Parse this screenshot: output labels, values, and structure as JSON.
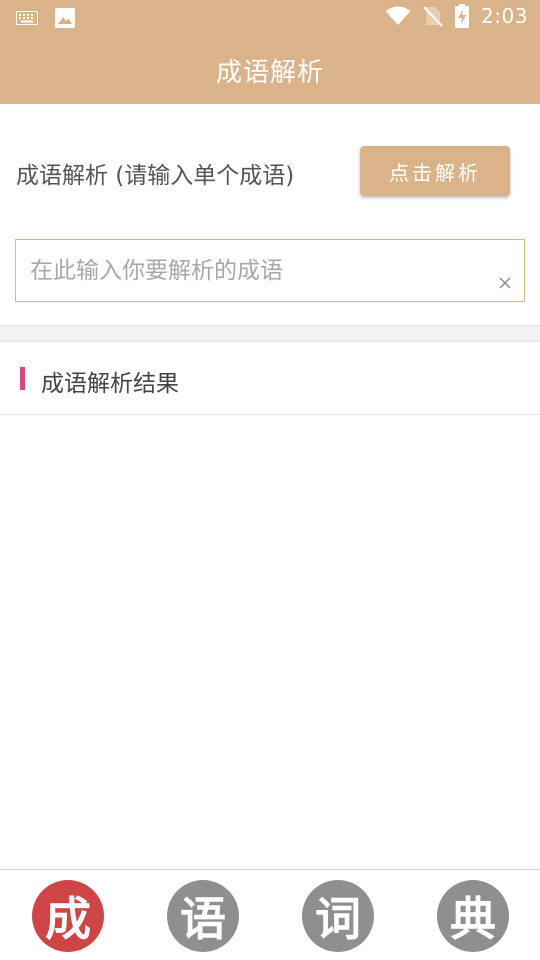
{
  "status_bar": {
    "time": "2:03",
    "left_icons": [
      "keyboard-icon",
      "image-icon"
    ],
    "right_icons": [
      "wifi-icon",
      "no-sim-icon",
      "battery-charging-icon"
    ]
  },
  "app_bar": {
    "title": "成语解析"
  },
  "form": {
    "prompt_label": "成语解析 (请输入单个成语)",
    "parse_button_label": "点击解析",
    "input_value": "",
    "input_placeholder": "在此输入你要解析的成语"
  },
  "result": {
    "title": "成语解析结果",
    "content": "",
    "accent_color": "#e0457b"
  },
  "bottom_nav": {
    "items": [
      {
        "label": "成",
        "active": true
      },
      {
        "label": "语",
        "active": false
      },
      {
        "label": "词",
        "active": false
      },
      {
        "label": "典",
        "active": false
      }
    ]
  },
  "colors": {
    "brand": "#dbb38a",
    "nav_active": "#cf4545",
    "nav_inactive": "#8f8f8f"
  }
}
